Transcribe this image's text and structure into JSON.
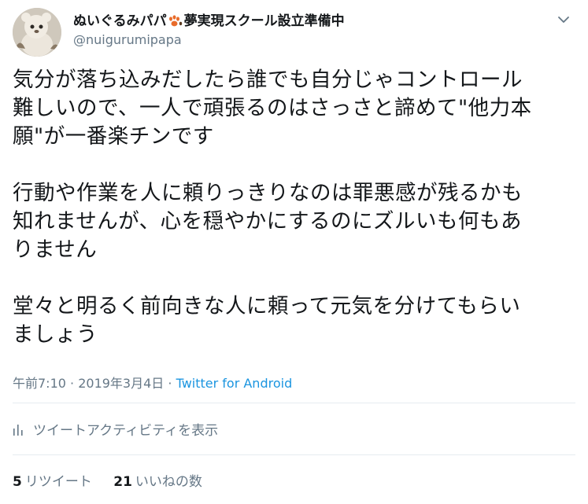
{
  "user": {
    "display_name": "ぬいぐるみパパ",
    "display_name_suffix": "夢実現スクール設立準備中",
    "handle": "@nuigurumipapa"
  },
  "tweet": {
    "text": "気分が落ち込みだしたら誰でも自分じゃコントロール\n難しいので、一人で頑張るのはさっさと諦めて\"他力本\n願\"が一番楽チンです\n\n行動や作業を人に頼りっきりなのは罪悪感が残るかも\n知れませんが、心を穏やかにするのにズルいも何もあ\nりません\n\n堂々と明るく前向きな人に頼って元気を分けてもらい\nましょう"
  },
  "meta": {
    "time": "午前7:10",
    "separator": " · ",
    "date": "2019年3月4日",
    "source": "Twitter for Android"
  },
  "activity": {
    "label": "ツイートアクティビティを表示"
  },
  "stats": {
    "retweets_count": "5",
    "retweets_label": "リツイート",
    "likes_count": "21",
    "likes_label": "いいねの数"
  },
  "icons": {
    "paw": "paw-icon",
    "caret": "chevron-down-icon",
    "activity": "bar-chart-icon"
  },
  "colors": {
    "text": "#14171a",
    "secondary": "#657786",
    "link": "#1b95e0",
    "divider": "#e6ecf0"
  }
}
